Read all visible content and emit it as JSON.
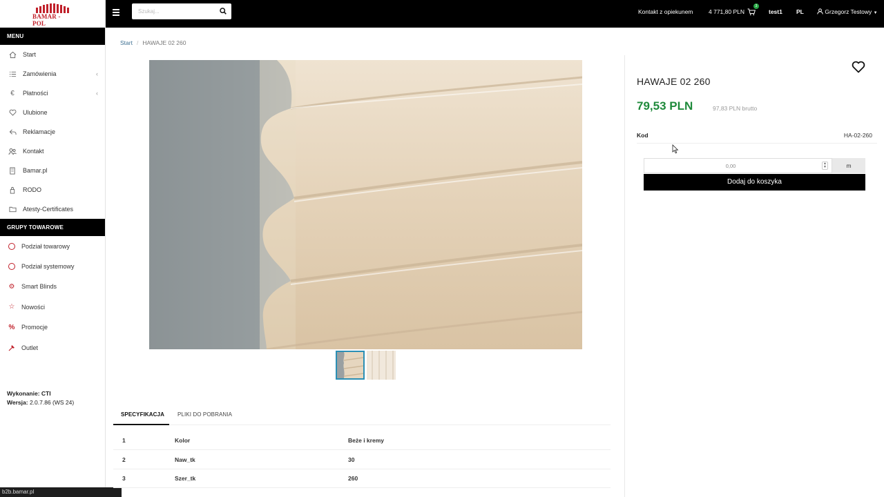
{
  "app": {
    "logo_text": "BAMAR - POL",
    "status_url": "b2b.bamar.pl"
  },
  "sidebar": {
    "menu_header": "MENU",
    "items": [
      {
        "label": "Start",
        "icon": "home-icon"
      },
      {
        "label": "Zamówienia",
        "icon": "list-icon"
      },
      {
        "label": "Płatności",
        "icon": "euro-icon"
      },
      {
        "label": "Ulubione",
        "icon": "heart-icon"
      },
      {
        "label": "Reklamacje",
        "icon": "reply-icon"
      },
      {
        "label": "Kontakt",
        "icon": "users-icon"
      },
      {
        "label": "Bamar.pl",
        "icon": "building-icon"
      },
      {
        "label": "RODO",
        "icon": "lock-icon"
      },
      {
        "label": "Atesty-Certificates",
        "icon": "folder-icon"
      }
    ],
    "groups_header": "GRUPY TOWAROWE",
    "groups": [
      {
        "label": "Podział towarowy",
        "icon": "circle-icon"
      },
      {
        "label": "Podział systemowy",
        "icon": "circle-icon"
      },
      {
        "label": "Smart Blinds",
        "icon": "cog-icon"
      },
      {
        "label": "Nowości",
        "icon": "star-icon"
      },
      {
        "label": "Promocje",
        "icon": "percent-icon"
      },
      {
        "label": "Outlet",
        "icon": "hammer-icon"
      }
    ],
    "footer": {
      "made_label": "Wykonanie:",
      "made_value": "CTI",
      "version_label": "Wersja:",
      "version_value": "2.0.7.86 (WS 24)"
    }
  },
  "topbar": {
    "search_placeholder": "Szukaj...",
    "contact": "Kontakt z opiekunem",
    "cart_amount": "4 771,80 PLN",
    "cart_count": "3",
    "company": "test1",
    "language": "PL",
    "user": "Grzegorz Testowy"
  },
  "breadcrumb": {
    "home": "Start",
    "current": "HAWAJE 02 260"
  },
  "product": {
    "title": "HAWAJE 02 260",
    "price_net": "79,53 PLN",
    "price_gross": "97,83 PLN brutto",
    "code_label": "Kod",
    "code_value": "HA-02-260",
    "qty_value": "0,00",
    "unit": "m",
    "add_to_cart": "Dodaj do koszyka"
  },
  "tabs": [
    "SPECYFIKACJA",
    "PLIKI DO POBRANIA"
  ],
  "spec_rows": [
    {
      "n": "1",
      "name": "Kolor",
      "value": "Beże i kremy"
    },
    {
      "n": "2",
      "name": "Naw_tk",
      "value": "30"
    },
    {
      "n": "3",
      "name": "Szer_tk",
      "value": "260"
    }
  ],
  "colors": {
    "accent_red": "#c0202a",
    "price_green": "#1f8a3b",
    "active_thumb": "#2a8fb5"
  }
}
